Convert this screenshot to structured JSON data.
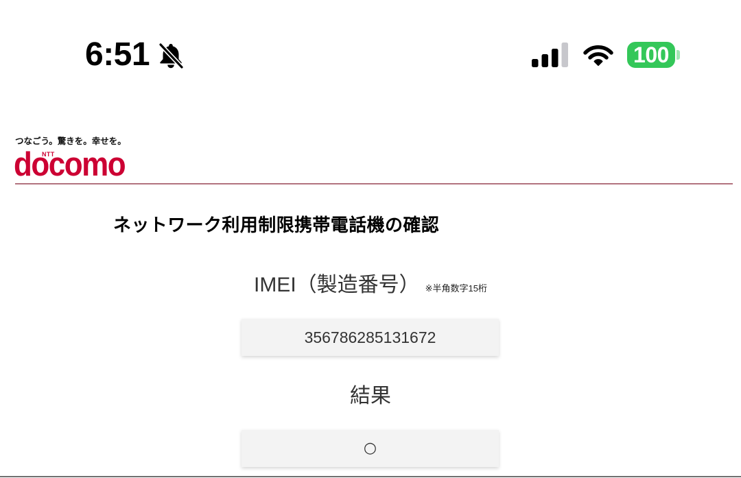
{
  "status_bar": {
    "time": "6:51",
    "silent_mode_icon": "bell-slash-icon",
    "signal_icon": "cellular-signal-icon",
    "signal_bars_filled": 3,
    "signal_bars_total": 4,
    "wifi_icon": "wifi-icon",
    "battery_icon": "battery-icon",
    "battery_level": "100"
  },
  "brand": {
    "tagline": "つなごう。驚きを。幸せを。",
    "ntt_mark": "NTT",
    "logo_text": "docomo"
  },
  "page": {
    "title": "ネットワーク利用制限携帯電話機の確認",
    "imei_label": "IMEI（製造番号）",
    "imei_note": "※半角数字15桁",
    "imei_value": "356786285131672",
    "result_label": "結果",
    "result_value": "○"
  },
  "colors": {
    "brand_red": "#cc0033",
    "divider": "#b2727e",
    "battery_green": "#34c759",
    "signal_active": "#000000",
    "signal_inactive": "#c7c7cc",
    "field_background": "#f3f3f3",
    "label_text": "#333333"
  }
}
